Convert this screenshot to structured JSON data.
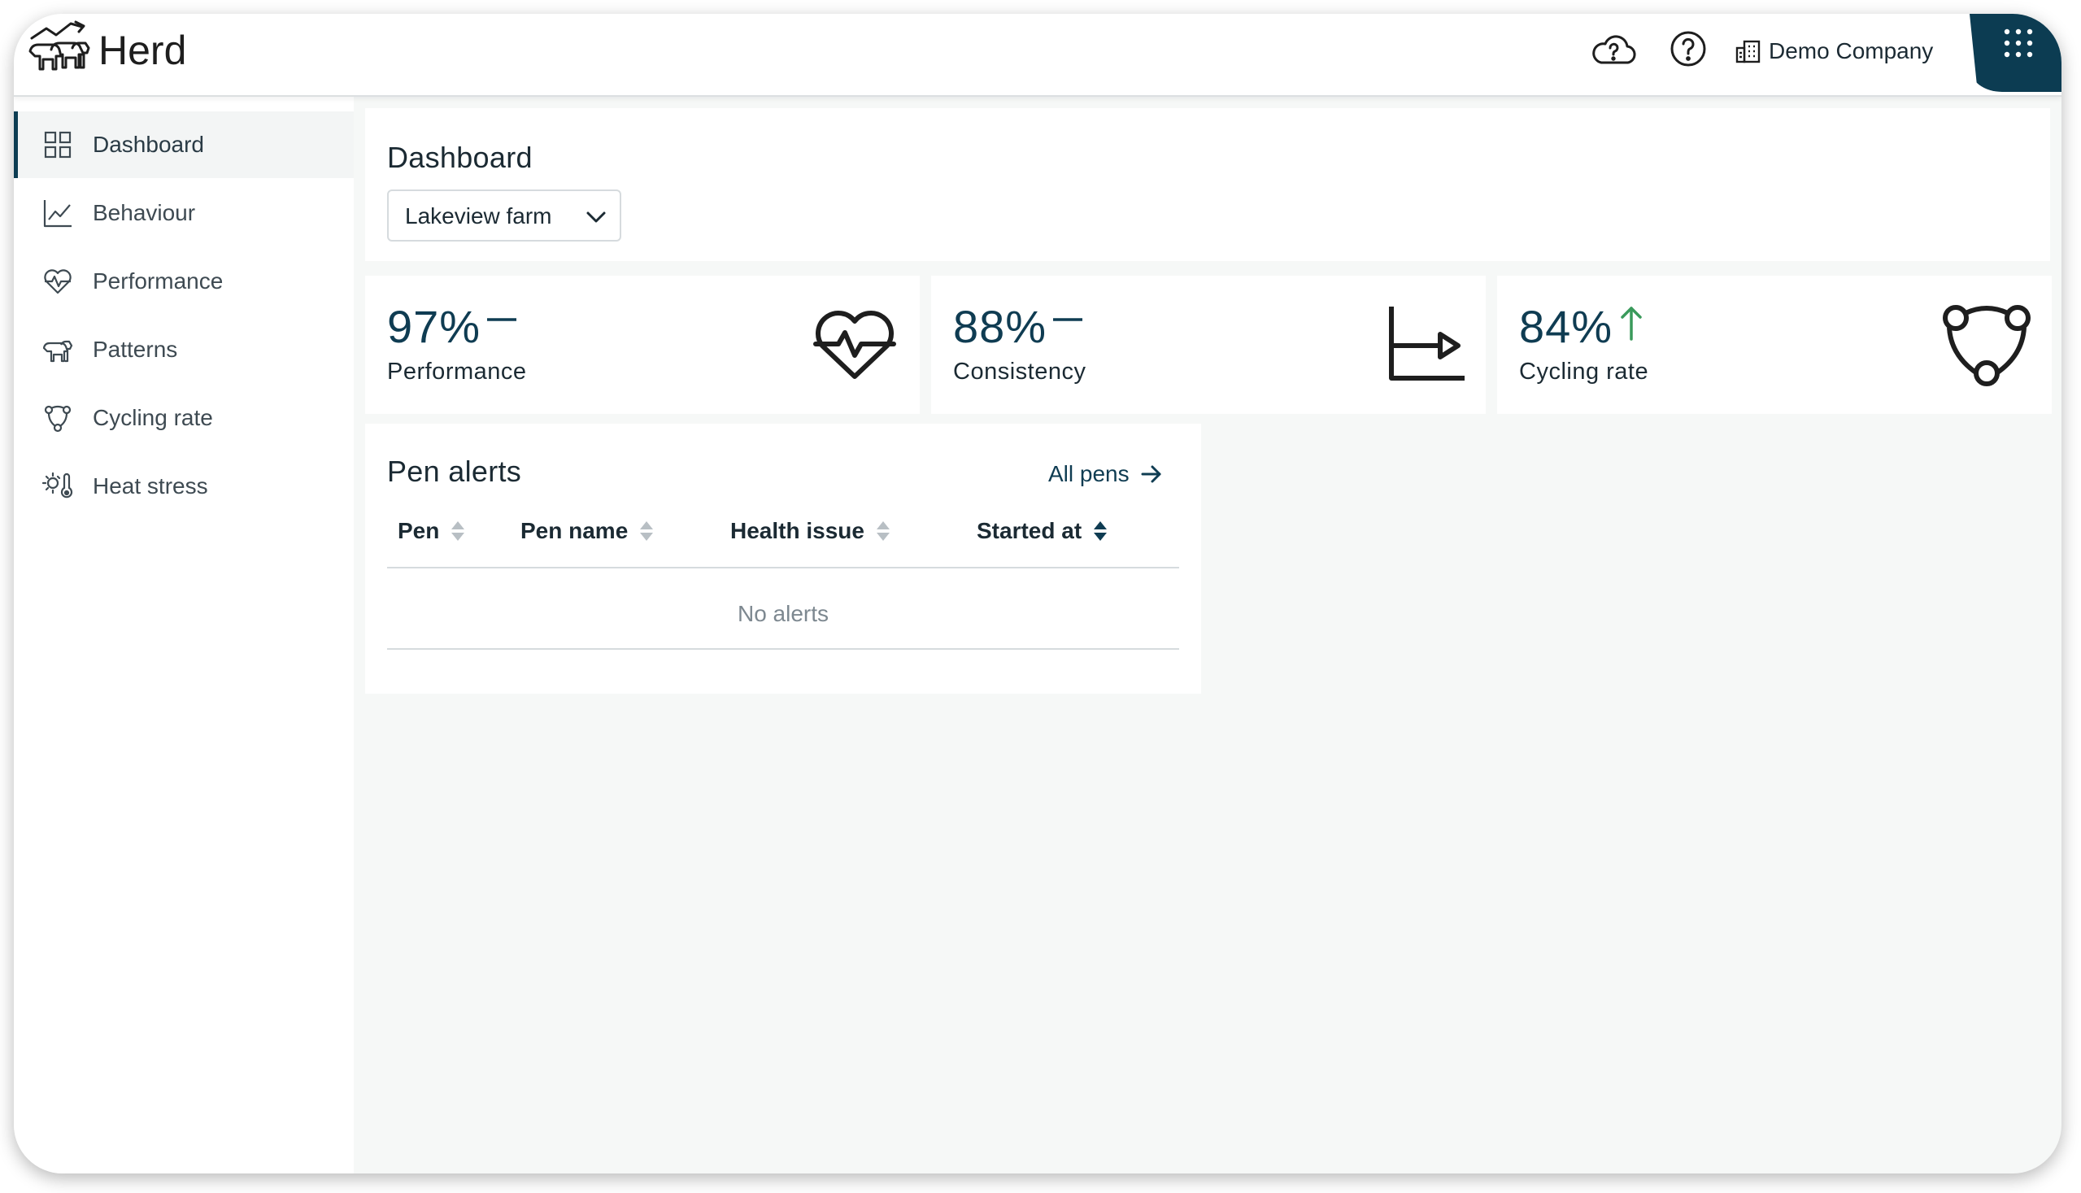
{
  "header": {
    "app_title": "Herd",
    "logo_icon": "herd-cows-chart-icon",
    "actions": [
      {
        "icon": "cloud-help-icon"
      },
      {
        "icon": "question-circle-icon"
      }
    ],
    "company": {
      "icon": "building-icon",
      "name": "Demo Company"
    },
    "apps_icon": "grid-dots-icon",
    "brand_color": "#0c3c52"
  },
  "sidebar": {
    "items": [
      {
        "label": "Dashboard",
        "icon": "grid-icon",
        "active": true
      },
      {
        "label": "Behaviour",
        "icon": "line-chart-icon",
        "active": false
      },
      {
        "label": "Performance",
        "icon": "heart-pulse-icon",
        "active": false
      },
      {
        "label": "Patterns",
        "icon": "cows-icon",
        "active": false
      },
      {
        "label": "Cycling rate",
        "icon": "cow-head-icon",
        "active": false
      },
      {
        "label": "Heat stress",
        "icon": "sun-thermometer-icon",
        "active": false
      }
    ]
  },
  "main": {
    "title": "Dashboard",
    "farm_select": {
      "value": "Lakeview farm"
    },
    "stats": [
      {
        "value": "97%",
        "trend": "flat",
        "label": "Performance",
        "icon": "heart-pulse-icon"
      },
      {
        "value": "88%",
        "trend": "flat",
        "label": "Consistency",
        "icon": "chart-arrow-icon"
      },
      {
        "value": "84%",
        "trend": "up",
        "label": "Cycling rate",
        "icon": "cow-head-icon",
        "trend_color": "#3a9a5b"
      }
    ],
    "pen_alerts": {
      "title": "Pen alerts",
      "link_label": "All pens",
      "columns": [
        {
          "label": "Pen",
          "sort": "none"
        },
        {
          "label": "Pen name",
          "sort": "none"
        },
        {
          "label": "Health issue",
          "sort": "none"
        },
        {
          "label": "Started at",
          "sort": "active"
        }
      ],
      "empty_message": "No alerts"
    }
  }
}
